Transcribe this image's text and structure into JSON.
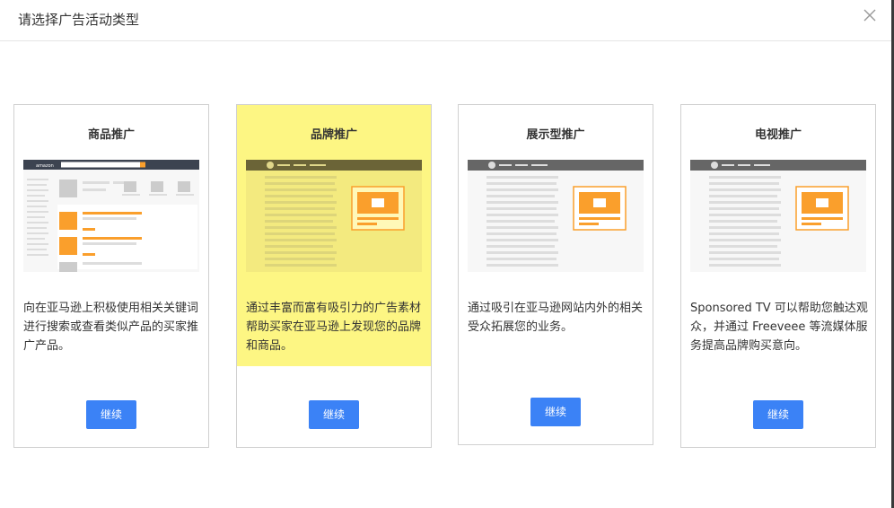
{
  "dialog": {
    "title": "请选择广告活动类型",
    "close_icon": "close-icon"
  },
  "colors": {
    "accent_orange": "#fa9f2c",
    "button_blue": "#3b82f6",
    "highlight_yellow": "#fdf683"
  },
  "cards": [
    {
      "title": "商品推广",
      "illus_brand": "amazon",
      "description": "向在亚马逊上积极使用相关关键词进行搜索或查看类似产品的买家推广产品。",
      "button": "继续"
    },
    {
      "title": "品牌推广",
      "description": "通过丰富而富有吸引力的广告素材帮助买家在亚马逊上发现您的品牌和商品。",
      "button": "继续"
    },
    {
      "title": "展示型推广",
      "description": "通过吸引在亚马逊网站内外的相关受众拓展您的业务。",
      "button": "继续"
    },
    {
      "title": "电视推广",
      "description": "Sponsored TV 可以帮助您触达观众，并通过 Freeveee 等流媒体服务提高品牌购买意向。",
      "button": "继续"
    }
  ]
}
